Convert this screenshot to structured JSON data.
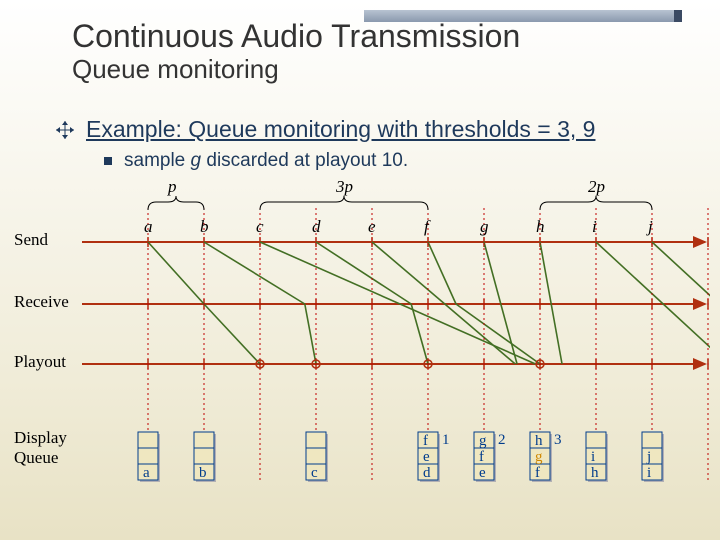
{
  "title": "Continuous Audio Transmission",
  "subtitle": "Queue monitoring",
  "bullet": "Example: Queue monitoring with thresholds = 3, 9",
  "subbullet_pre": "sample ",
  "subbullet_em": "g",
  "subbullet_post": " discarded at playout 10.",
  "rows": {
    "send": "Send",
    "receive": "Receive",
    "playout": "Playout",
    "display": "Display\nQueue"
  },
  "spans": {
    "p": "p",
    "p3": "3p",
    "p2": "2p"
  },
  "chart_data": {
    "type": "timeline",
    "title": "Queue monitoring example, thresholds 3 and 9, sample g discarded at playout 10",
    "x_unit": "p",
    "samples": [
      "a",
      "b",
      "c",
      "d",
      "e",
      "f",
      "g",
      "h",
      "i",
      "j"
    ],
    "send_times": [
      1,
      2,
      3,
      4,
      5,
      6,
      7,
      8,
      9,
      10
    ],
    "receive_times": [
      2,
      3.8,
      5.5,
      5.7,
      6.3,
      6.5,
      7.3,
      8.2,
      10.2,
      11.2
    ],
    "playout_times": [
      3,
      4,
      null,
      6,
      null,
      8,
      null,
      null,
      null,
      null
    ],
    "span_labels": [
      {
        "label": "p",
        "from": 1,
        "to": 2
      },
      {
        "label": "3p",
        "from": 3,
        "to": 6
      },
      {
        "label": "2p",
        "from": 8,
        "to": 10
      }
    ],
    "queue_snapshots": [
      {
        "x": 1,
        "stack": [
          "a"
        ],
        "count": null
      },
      {
        "x": 2,
        "stack": [
          "b"
        ],
        "count": null
      },
      {
        "x": 4,
        "stack": [
          "c"
        ],
        "count": null
      },
      {
        "x": 6,
        "stack": [
          "d",
          "e",
          "f"
        ],
        "count": 1
      },
      {
        "x": 7,
        "stack": [
          "e",
          "f",
          "g"
        ],
        "count": 2
      },
      {
        "x": 8,
        "stack": [
          "f",
          "g",
          "h"
        ],
        "count": 3
      },
      {
        "x": 9,
        "stack": [
          "h",
          "i"
        ],
        "count": null
      },
      {
        "x": 10,
        "stack": [
          "i",
          "j"
        ],
        "count": null
      }
    ],
    "discarded": [
      "g"
    ]
  }
}
